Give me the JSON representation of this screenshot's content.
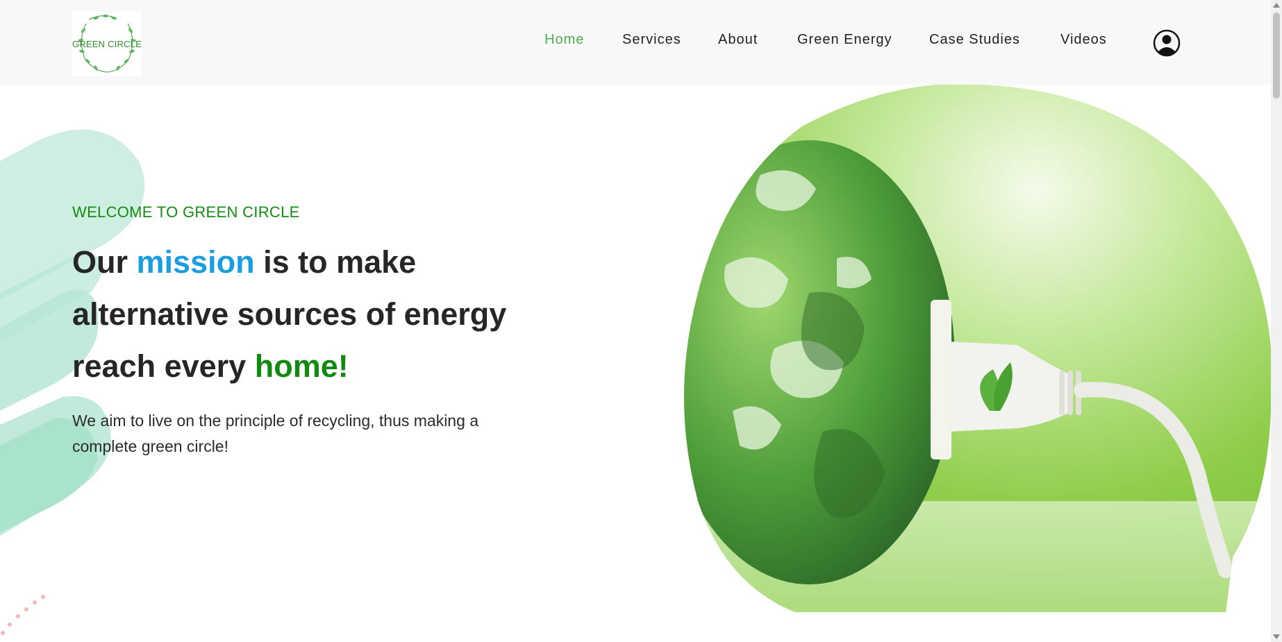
{
  "logo": {
    "text": "GREEN CIRCLE"
  },
  "nav": {
    "items": [
      {
        "label": "Home",
        "active": true
      },
      {
        "label": "Services",
        "active": false
      },
      {
        "label": "About",
        "active": false
      },
      {
        "label": "Green Energy",
        "active": false
      },
      {
        "label": "Case Studies",
        "active": false
      },
      {
        "label": "Videos",
        "active": false
      }
    ],
    "user_icon": "user-circle-icon"
  },
  "hero": {
    "eyebrow": "WELCOME TO GREEN CIRCLE",
    "headline": {
      "part1": "Our ",
      "highlight1": "mission",
      "part2": " is to make alternative sources of energy reach every ",
      "highlight2": "home!"
    },
    "description": "We aim to live on the principle of recycling, thus making a complete green circle!",
    "image_icon": "earth-plug-illustration"
  },
  "colors": {
    "accent_green": "#4caf50",
    "headline_blue": "#1a9ee0",
    "headline_green": "#128a12",
    "header_bg": "#f8f8f8"
  }
}
